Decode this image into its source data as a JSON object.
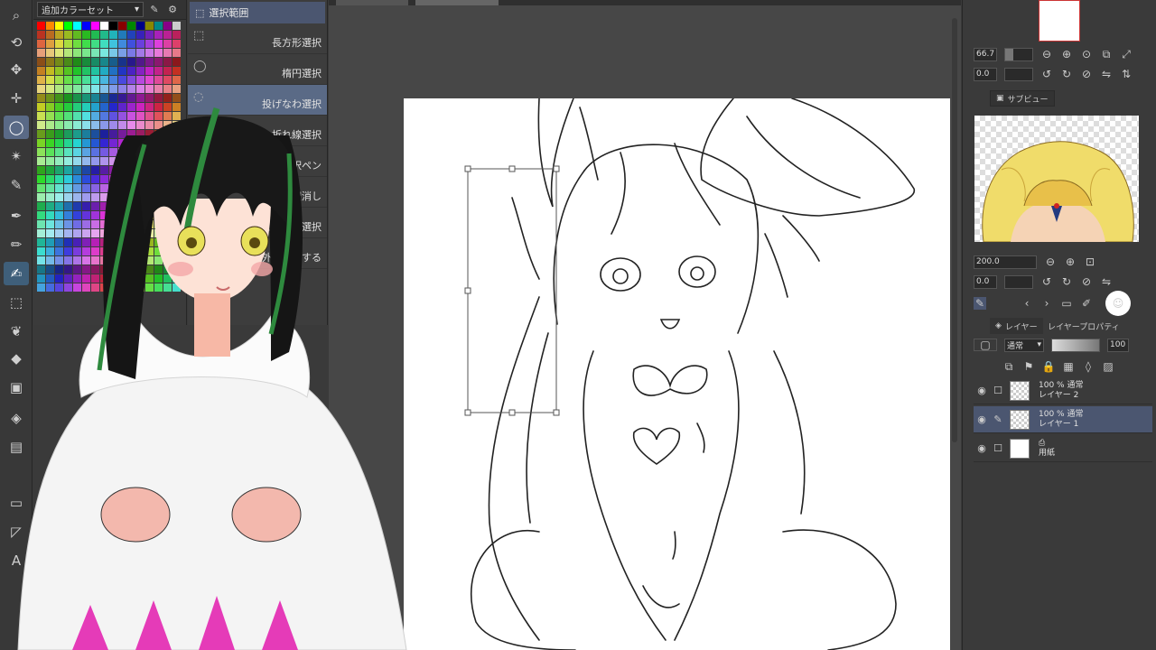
{
  "colorset": {
    "dropdown_label": "追加カラーセット",
    "swatch_colors": [
      "#ff0000",
      "#ff8800",
      "#ffff00",
      "#00ff00",
      "#00ffff",
      "#0000ff",
      "#ff00ff",
      "#ffffff",
      "#000000",
      "#880000",
      "#008800",
      "#000088",
      "#888800",
      "#008888",
      "#880088",
      "#cccccc"
    ]
  },
  "subtool": {
    "header_label": "選択範囲",
    "items": [
      {
        "label": "長方形選択",
        "icon": "rectangle-select-icon"
      },
      {
        "label": "楕円選択",
        "icon": "ellipse-select-icon"
      },
      {
        "label": "投げなわ選択",
        "icon": "lasso-select-icon"
      },
      {
        "label": "折れ線選択",
        "icon": "polyline-select-icon"
      },
      {
        "label": "選択ペン",
        "icon": "select-pen-icon"
      },
      {
        "label": "選択消し",
        "icon": "select-eraser-icon"
      },
      {
        "label": "シュリンク選択",
        "icon": "shrink-select-icon"
      },
      {
        "label": "範囲外を選択する",
        "icon": "select-outside-icon"
      }
    ]
  },
  "navigator": {
    "zoom": "66.7",
    "rotate": "0.0"
  },
  "subview": {
    "tab_label": "サブビュー",
    "zoom": "200.0",
    "rotate": "0.0"
  },
  "layers": {
    "tab_layer": "レイヤー",
    "tab_property": "レイヤープロパティ",
    "blend_mode": "通常",
    "opacity": "100",
    "rows": [
      {
        "line1": "100 % 通常",
        "line2": "レイヤー 2",
        "active": false
      },
      {
        "line1": "100 % 通常",
        "line2": "レイヤー 1",
        "active": true
      },
      {
        "line1": "",
        "line2": "用紙",
        "active": false
      }
    ]
  }
}
